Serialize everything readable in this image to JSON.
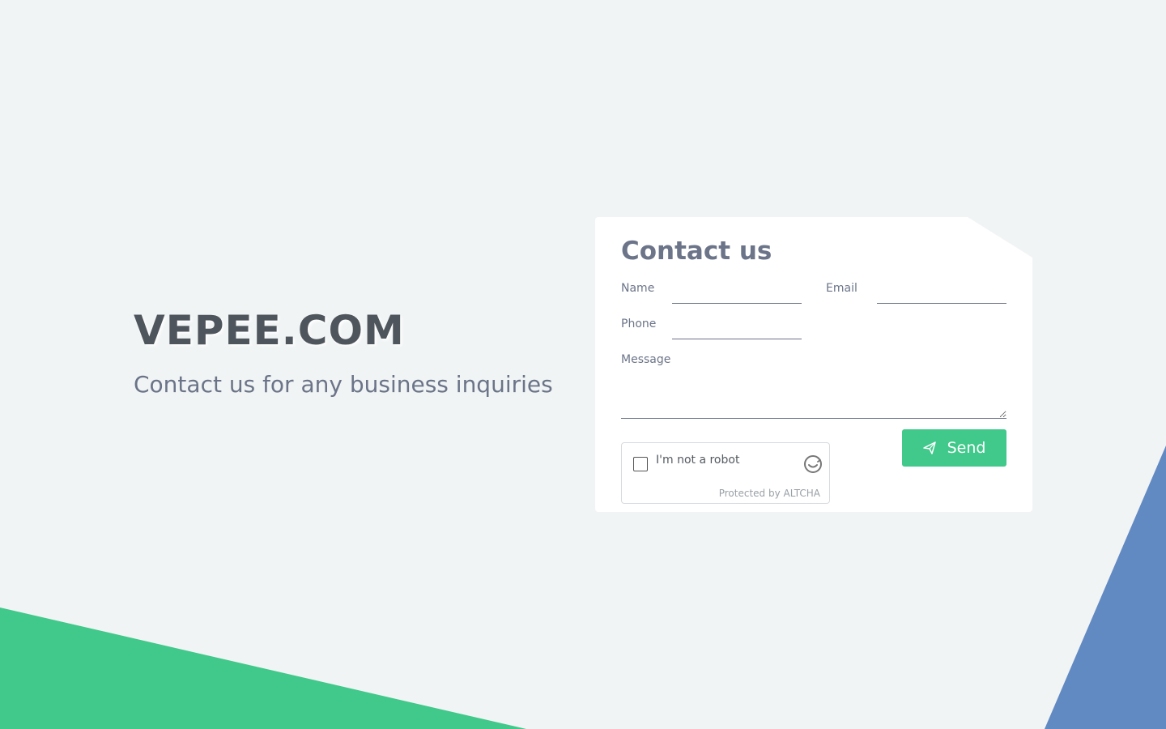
{
  "brand": {
    "title": "VEPEE.COM",
    "subtitle": "Contact us for any business inquiries"
  },
  "form": {
    "title": "Contact us",
    "name_label": "Name",
    "email_label": "Email",
    "phone_label": "Phone",
    "message_label": "Message",
    "name_value": "",
    "email_value": "",
    "phone_value": "",
    "message_value": "",
    "send_label": "Send",
    "send_icon": "paper-plane-icon"
  },
  "captcha": {
    "label": "I'm not a robot",
    "checked": false,
    "footer": "Protected by ALTCHA",
    "icon": "altcha-logo-icon"
  },
  "colors": {
    "background": "#f1f4f5",
    "green_accent": "#40c98a",
    "blue_accent": "#6189c2",
    "text_muted": "#6b7488",
    "title_dark": "#4f555c"
  }
}
